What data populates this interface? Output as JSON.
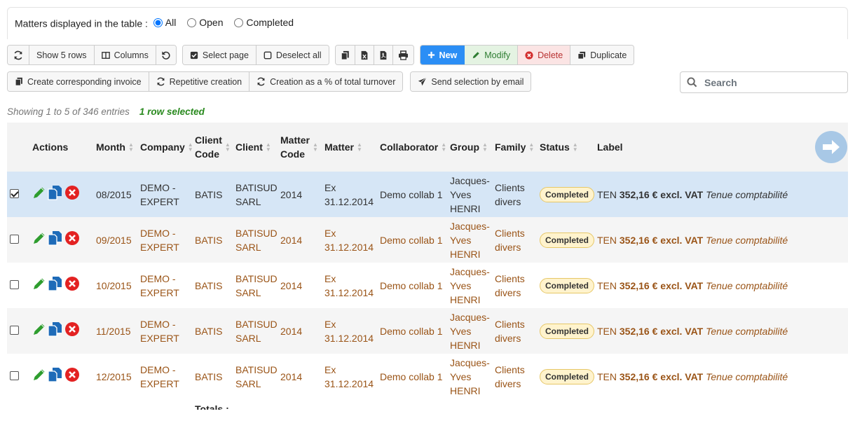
{
  "filter": {
    "label": "Matters displayed in the table :",
    "options": [
      "All",
      "Open",
      "Completed"
    ],
    "selected": "All"
  },
  "toolbar1": {
    "show_rows": "Show 5 rows",
    "columns": "Columns",
    "select_page": "Select page",
    "deselect_all": "Deselect all",
    "new": "New",
    "modify": "Modify",
    "delete": "Delete",
    "duplicate": "Duplicate"
  },
  "toolbar2": {
    "create_invoice": "Create corresponding invoice",
    "repetitive": "Repetitive creation",
    "creation_pct": "Creation as a % of total turnover",
    "send_email": "Send selection by email"
  },
  "search": {
    "placeholder": "Search"
  },
  "info": {
    "showing": "Showing 1 to 5 of 346 entries",
    "selected": "1 row selected"
  },
  "table": {
    "headers": {
      "actions": "Actions",
      "month": "Month",
      "company": "Company",
      "client_code_1": "Client",
      "client_code_2": "Code",
      "client": "Client",
      "matter_code_1": "Matter",
      "matter_code_2": "Code",
      "matter": "Matter",
      "collaborator": "Collaborator",
      "group": "Group",
      "family": "Family",
      "status": "Status",
      "label": "Label"
    },
    "rows": [
      {
        "month": "08/2015",
        "company_1": "DEMO -",
        "company_2": "EXPERT",
        "client_code": "BATIS",
        "client_1": "BATISUD",
        "client_2": "SARL",
        "matter_code": "2014",
        "matter_1": "Ex",
        "matter_2": "31.12.2014",
        "collaborator": "Demo collab 1",
        "group_1": "Jacques-",
        "group_2": "Yves",
        "group_3": "HENRI",
        "family_1": "Clients",
        "family_2": "divers",
        "status": "Completed",
        "label_prefix": "TEN",
        "label_amount": "352,16 € excl. VAT",
        "label_desc": "Tenue comptabilité",
        "checked": true
      },
      {
        "month": "09/2015",
        "company_1": "DEMO -",
        "company_2": "EXPERT",
        "client_code": "BATIS",
        "client_1": "BATISUD",
        "client_2": "SARL",
        "matter_code": "2014",
        "matter_1": "Ex",
        "matter_2": "31.12.2014",
        "collaborator": "Demo collab 1",
        "group_1": "Jacques-",
        "group_2": "Yves",
        "group_3": "HENRI",
        "family_1": "Clients",
        "family_2": "divers",
        "status": "Completed",
        "label_prefix": "TEN",
        "label_amount": "352,16 € excl. VAT",
        "label_desc": "Tenue comptabilité",
        "checked": false
      },
      {
        "month": "10/2015",
        "company_1": "DEMO -",
        "company_2": "EXPERT",
        "client_code": "BATIS",
        "client_1": "BATISUD",
        "client_2": "SARL",
        "matter_code": "2014",
        "matter_1": "Ex",
        "matter_2": "31.12.2014",
        "collaborator": "Demo collab 1",
        "group_1": "Jacques-",
        "group_2": "Yves",
        "group_3": "HENRI",
        "family_1": "Clients",
        "family_2": "divers",
        "status": "Completed",
        "label_prefix": "TEN",
        "label_amount": "352,16 € excl. VAT",
        "label_desc": "Tenue comptabilité",
        "checked": false
      },
      {
        "month": "11/2015",
        "company_1": "DEMO -",
        "company_2": "EXPERT",
        "client_code": "BATIS",
        "client_1": "BATISUD",
        "client_2": "SARL",
        "matter_code": "2014",
        "matter_1": "Ex",
        "matter_2": "31.12.2014",
        "collaborator": "Demo collab 1",
        "group_1": "Jacques-",
        "group_2": "Yves",
        "group_3": "HENRI",
        "family_1": "Clients",
        "family_2": "divers",
        "status": "Completed",
        "label_prefix": "TEN",
        "label_amount": "352,16 € excl. VAT",
        "label_desc": "Tenue comptabilité",
        "checked": false
      },
      {
        "month": "12/2015",
        "company_1": "DEMO -",
        "company_2": "EXPERT",
        "client_code": "BATIS",
        "client_1": "BATISUD",
        "client_2": "SARL",
        "matter_code": "2014",
        "matter_1": "Ex",
        "matter_2": "31.12.2014",
        "collaborator": "Demo collab 1",
        "group_1": "Jacques-",
        "group_2": "Yves",
        "group_3": "HENRI",
        "family_1": "Clients",
        "family_2": "divers",
        "status": "Completed",
        "label_prefix": "TEN",
        "label_amount": "352,16 € excl. VAT",
        "label_desc": "Tenue comptabilité",
        "checked": false
      }
    ],
    "totals_label": "Totals :"
  },
  "colors": {
    "primary": "#2b8ef5",
    "modify": "#2e7d32",
    "delete": "#b83232",
    "row_text": "#9a5417",
    "selected_row": "#d6e6f6",
    "badge_bg": "#fff3cd"
  },
  "icons": [
    "refresh-icon",
    "columns-icon",
    "undo-icon",
    "check-square-icon",
    "square-icon",
    "copy-icon",
    "excel-icon",
    "pdf-icon",
    "print-icon",
    "plus-icon",
    "pencil-icon",
    "times-circle-icon",
    "duplicate-icon",
    "invoice-icon",
    "sync-icon",
    "paper-plane-icon",
    "search-icon",
    "arrow-right-icon"
  ]
}
